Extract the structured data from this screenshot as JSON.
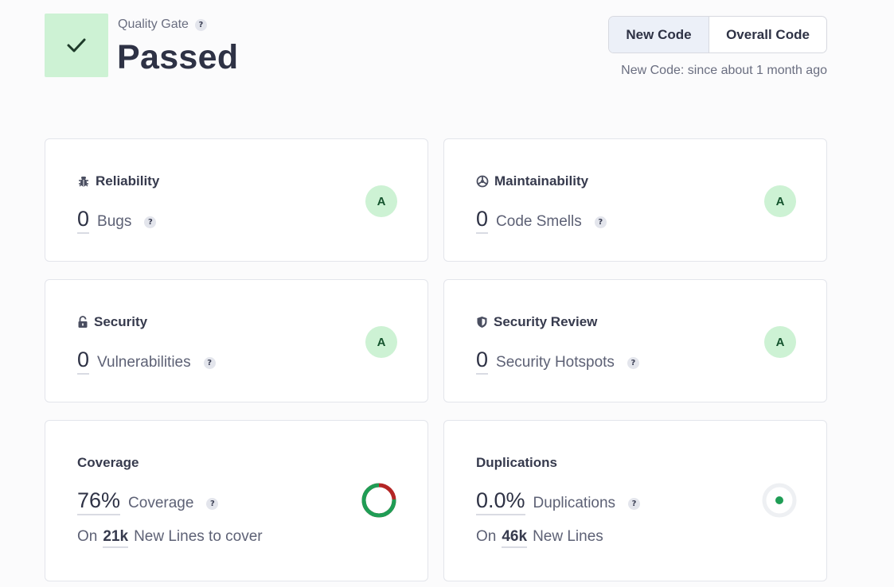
{
  "header": {
    "quality_gate_label": "Quality Gate",
    "status": "Passed",
    "status_color": "#cdf2d4",
    "check_icon": "check-icon"
  },
  "period_toggle": {
    "options": [
      "New Code",
      "Overall Code"
    ],
    "selected": "New Code",
    "since": "New Code: since about 1 month ago"
  },
  "cards": {
    "reliability": {
      "title": "Reliability",
      "value": "0",
      "unit": "Bugs",
      "rating": "A",
      "icon": "bug-icon"
    },
    "maintainability": {
      "title": "Maintainability",
      "value": "0",
      "unit": "Code Smells",
      "rating": "A",
      "icon": "maintainability-icon"
    },
    "security": {
      "title": "Security",
      "value": "0",
      "unit": "Vulnerabilities",
      "rating": "A",
      "icon": "lock-icon"
    },
    "security_review": {
      "title": "Security Review",
      "value": "0",
      "unit": "Security Hotspots",
      "rating": "A",
      "icon": "shield-icon"
    },
    "coverage": {
      "title": "Coverage",
      "value": "76%",
      "unit": "Coverage",
      "sub_prefix": "On",
      "sub_count": "21k",
      "sub_suffix": "New Lines to cover",
      "percent": 76,
      "covered_color": "#1f9d55",
      "uncovered_color": "#b42525"
    },
    "duplications": {
      "title": "Duplications",
      "value": "0.0%",
      "unit": "Duplications",
      "sub_prefix": "On",
      "sub_count": "46k",
      "sub_suffix": "New Lines",
      "indicator_color": "#1f9d55"
    }
  },
  "help_glyph": "?"
}
